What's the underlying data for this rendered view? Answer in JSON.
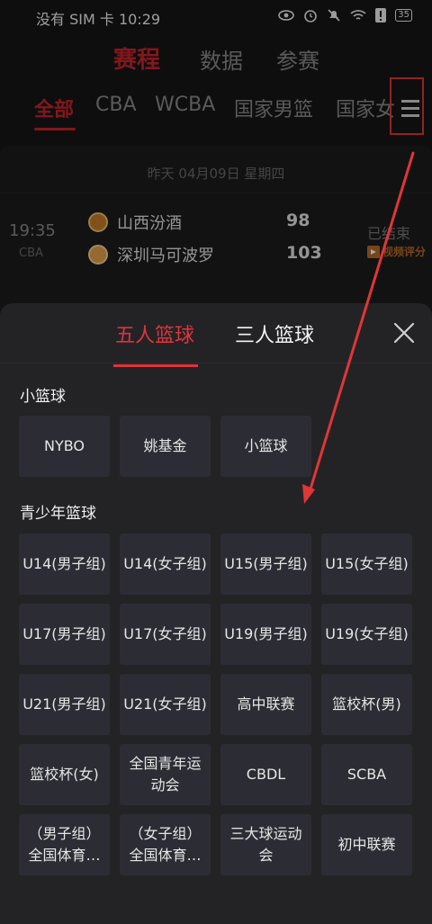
{
  "status_bar": {
    "left": "没有 SIM 卡 10:29",
    "battery": "35"
  },
  "top_nav": {
    "items": [
      "赛程",
      "数据",
      "参赛"
    ]
  },
  "categories": [
    "全部",
    "CBA",
    "WCBA",
    "国家男篮",
    "国家女"
  ],
  "schedule": {
    "date": "昨天 04月09日 星期四",
    "match": {
      "time": "19:35",
      "league": "CBA",
      "home": {
        "name": "山西汾酒",
        "score": "98"
      },
      "away": {
        "name": "深圳马可波罗",
        "score": "103"
      },
      "status": "已结束",
      "badge": "视频评分"
    }
  },
  "sheet": {
    "tabs": [
      "五人篮球",
      "三人篮球"
    ],
    "sections": [
      {
        "title": "小篮球",
        "items": [
          "NYBO",
          "姚基金",
          "小篮球"
        ]
      },
      {
        "title": "青少年篮球",
        "items": [
          "U14(男子组)",
          "U14(女子组)",
          "U15(男子组)",
          "U15(女子组)",
          "U17(男子组)",
          "U17(女子组)",
          "U19(男子组)",
          "U19(女子组)",
          "U21(男子组)",
          "U21(女子组)",
          "高中联赛",
          "篮校杯(男)",
          "篮校杯(女)",
          "全国青年运动会",
          "CBDL",
          "SCBA",
          "（男子组）全国体育…",
          "（女子组）全国体育…",
          "三大球运动会",
          "初中联赛"
        ]
      }
    ]
  },
  "colors": {
    "accent": "#e0333a",
    "annotation": "#e03636"
  }
}
